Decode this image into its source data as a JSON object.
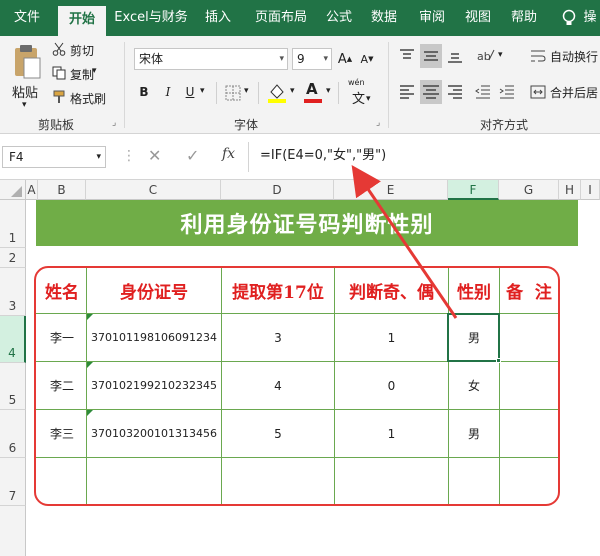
{
  "menu": {
    "tabs": [
      "文件",
      "开始",
      "Excel与财务",
      "插入",
      "页面布局",
      "公式",
      "数据",
      "审阅",
      "视图",
      "帮助",
      "操"
    ],
    "active_index": 1
  },
  "ribbon": {
    "clipboard": {
      "paste": "粘贴",
      "cut": "剪切",
      "copy": "复制",
      "format_painter": "格式刷",
      "group": "剪贴板"
    },
    "font": {
      "name": "宋体",
      "size": "9",
      "bold": "B",
      "italic": "I",
      "underline": "U",
      "font_color_glyph": "A",
      "phonetic": "wén",
      "group": "字体"
    },
    "alignment": {
      "wrap": "自动换行",
      "merge": "合并后居",
      "group": "对齐方式"
    }
  },
  "formula_bar": {
    "name_box": "F4",
    "fx": "fx",
    "formula": "=IF(E4=0,\"女\",\"男\")"
  },
  "grid": {
    "columns": [
      "A",
      "B",
      "C",
      "D",
      "E",
      "F",
      "G",
      "H",
      "I"
    ],
    "selected_column": "F",
    "rows": [
      "1",
      "2",
      "3",
      "4",
      "5",
      "6",
      "7"
    ],
    "selected_row": "4",
    "title": "利用身份证号码判断性别",
    "headers": [
      "姓名",
      "身份证号",
      "提取第17位",
      "判断奇、偶",
      "性别",
      "备  注"
    ],
    "data": [
      [
        "李一",
        "370101198106091234",
        "3",
        "1",
        "男",
        ""
      ],
      [
        "李二",
        "370102199210232345",
        "4",
        "0",
        "女",
        ""
      ],
      [
        "李三",
        "370103200101313456",
        "5",
        "1",
        "男",
        ""
      ],
      [
        "",
        "",
        "",
        "",
        "",
        ""
      ]
    ]
  },
  "colors": {
    "excel_green": "#217346",
    "title_band": "#70ad47",
    "header_text": "#e02020",
    "annotation": "#e53935"
  }
}
